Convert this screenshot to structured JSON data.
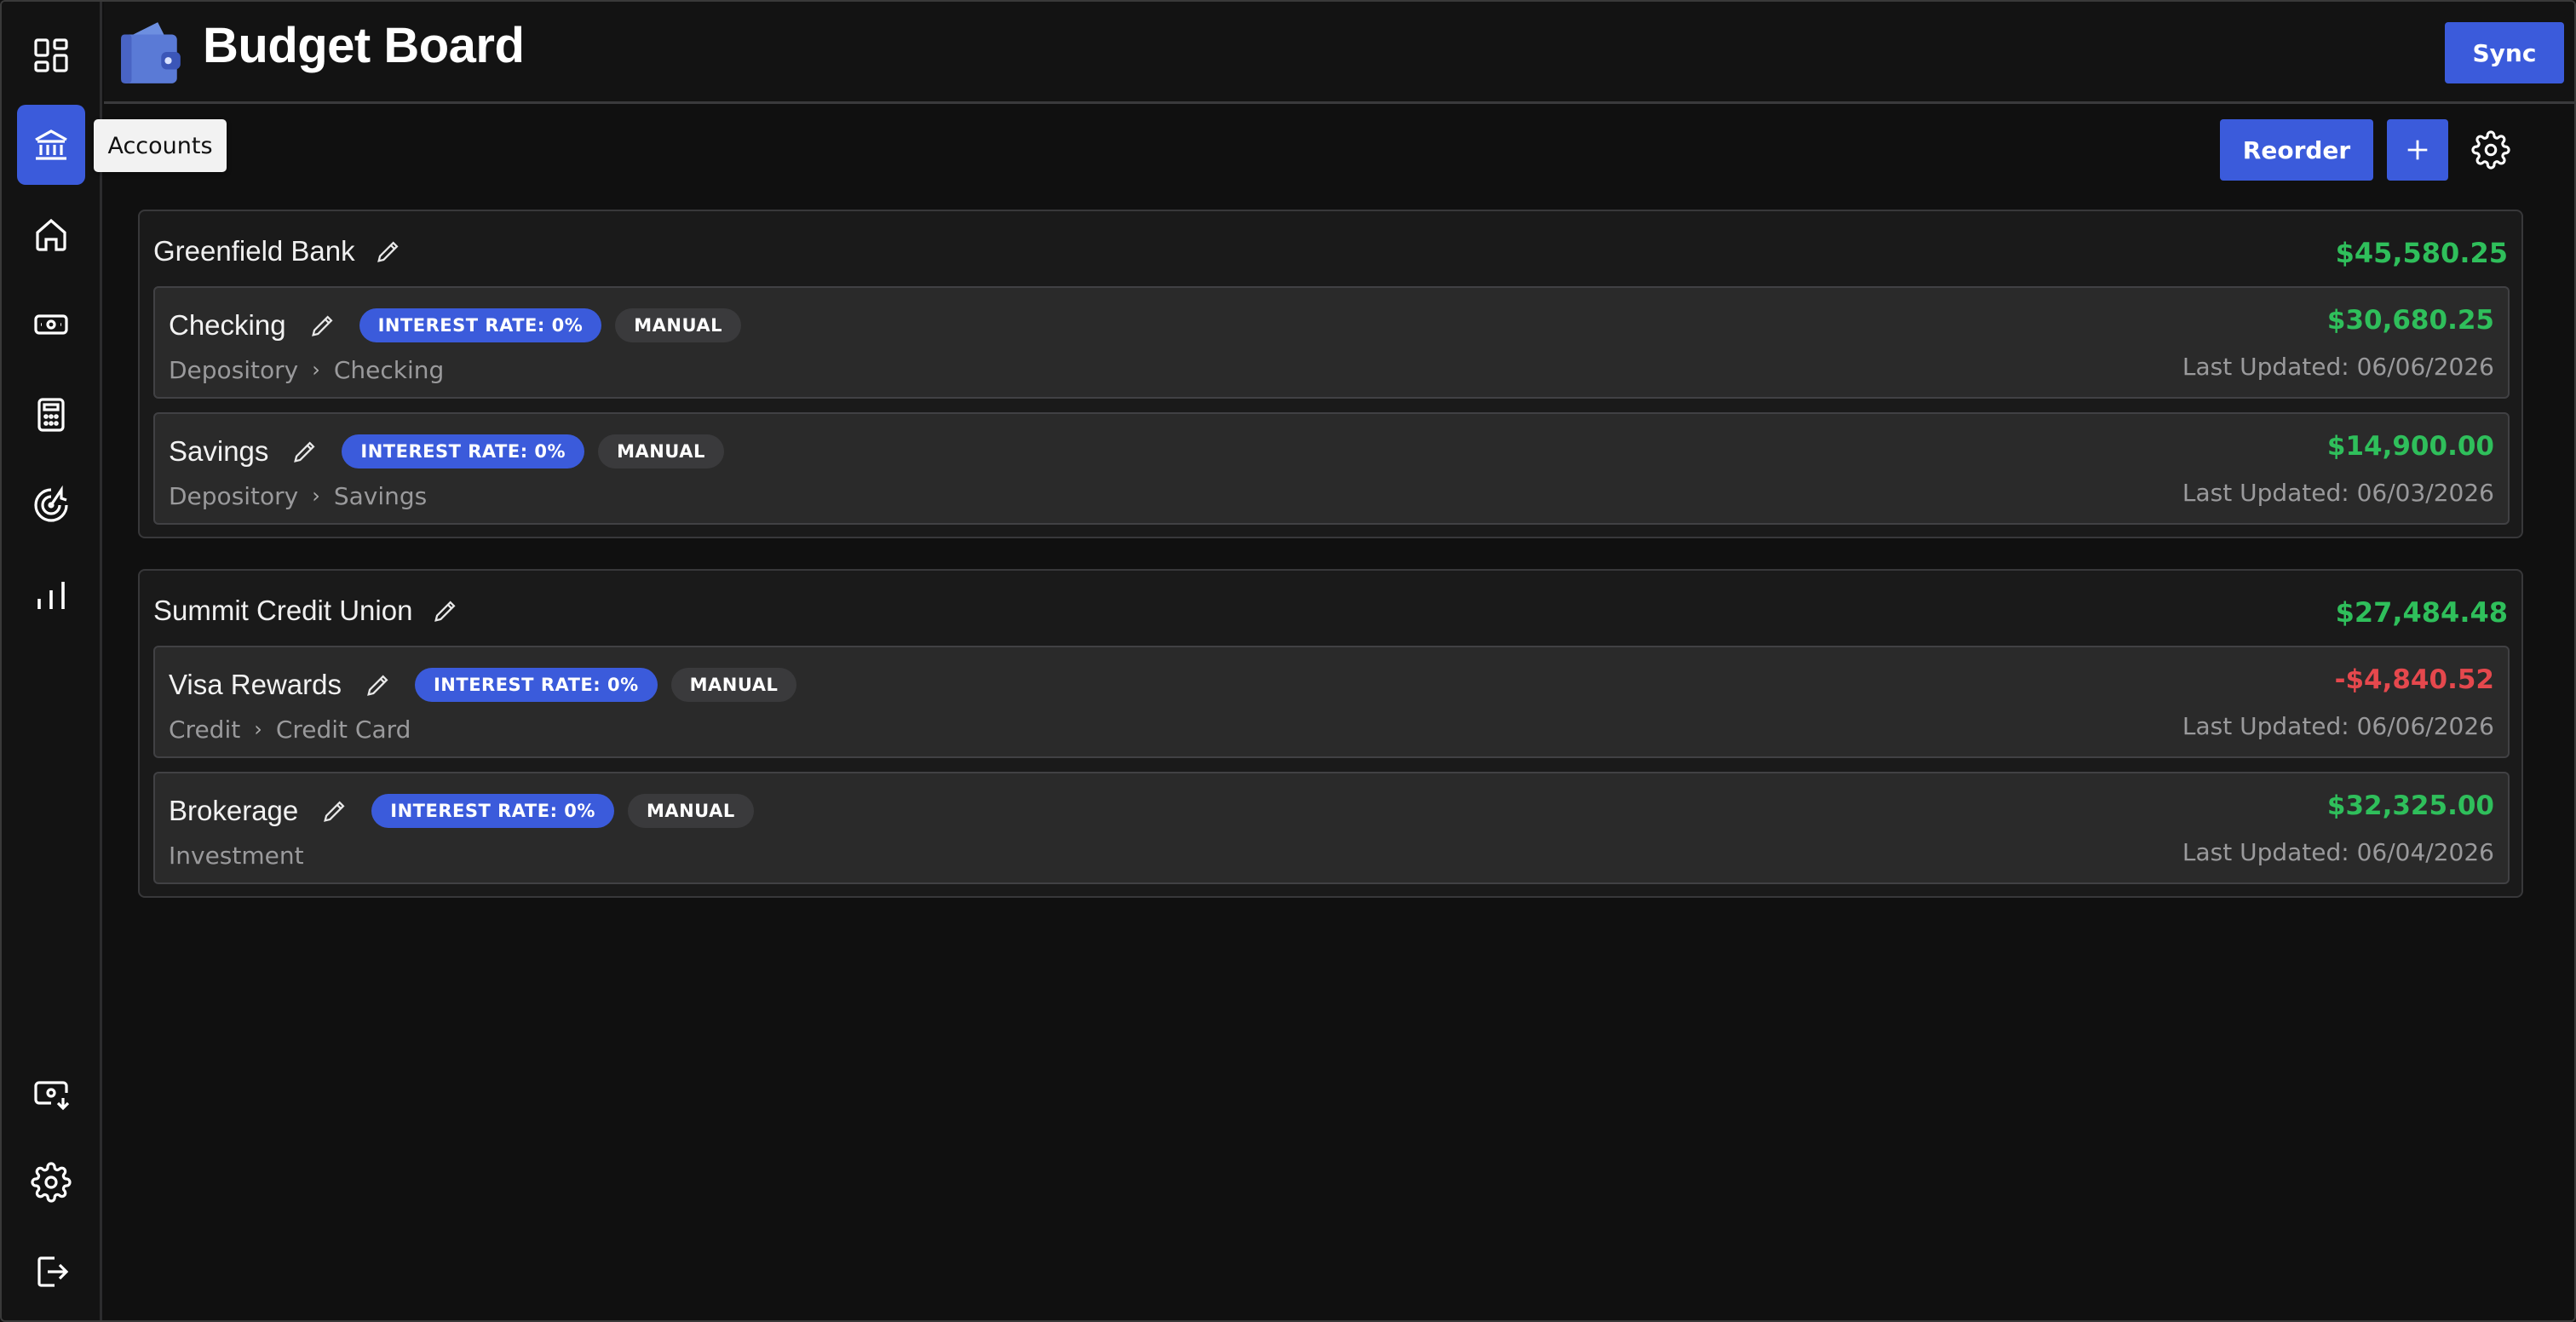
{
  "app": {
    "title": "Budget Board",
    "sync_label": "Sync"
  },
  "sidebar": {
    "tooltip": "Accounts",
    "items": [
      {
        "name": "dashboard",
        "icon": "dashboard-icon"
      },
      {
        "name": "accounts",
        "icon": "bank-icon",
        "active": true
      },
      {
        "name": "home",
        "icon": "home-icon"
      },
      {
        "name": "transactions",
        "icon": "cash-icon"
      },
      {
        "name": "budgets",
        "icon": "calculator-icon"
      },
      {
        "name": "goals",
        "icon": "target-icon"
      },
      {
        "name": "trends",
        "icon": "bar-chart-icon"
      }
    ],
    "bottom_items": [
      {
        "name": "import",
        "icon": "cash-download-icon"
      },
      {
        "name": "settings",
        "icon": "gear-icon"
      },
      {
        "name": "logout",
        "icon": "logout-icon"
      }
    ]
  },
  "toolbar": {
    "reorder_label": "Reorder"
  },
  "groups": [
    {
      "name": "Greenfield Bank",
      "total": "$45,580.25",
      "accounts": [
        {
          "name": "Checking",
          "interest": "INTEREST RATE: 0%",
          "badge": "MANUAL",
          "type": "Depository",
          "subtype": "Checking",
          "balance": "$30,680.25",
          "updated": "Last Updated: 06/06/2026"
        },
        {
          "name": "Savings",
          "interest": "INTEREST RATE: 0%",
          "badge": "MANUAL",
          "type": "Depository",
          "subtype": "Savings",
          "balance": "$14,900.00",
          "updated": "Last Updated: 06/03/2026"
        }
      ]
    },
    {
      "name": "Summit Credit Union",
      "total": "$27,484.48",
      "accounts": [
        {
          "name": "Visa Rewards",
          "interest": "INTEREST RATE: 0%",
          "badge": "MANUAL",
          "type": "Credit",
          "subtype": "Credit Card",
          "balance": "-$4,840.52",
          "updated": "Last Updated: 06/06/2026"
        },
        {
          "name": "Brokerage",
          "interest": "INTEREST RATE: 0%",
          "badge": "MANUAL",
          "type": "Investment",
          "subtype": "",
          "balance": "$32,325.00",
          "updated": "Last Updated: 06/04/2026"
        }
      ]
    }
  ],
  "colors": {
    "accent": "#3b5bdb",
    "positive": "#2fbf5b",
    "negative": "#e5484d",
    "background": "#101010"
  }
}
